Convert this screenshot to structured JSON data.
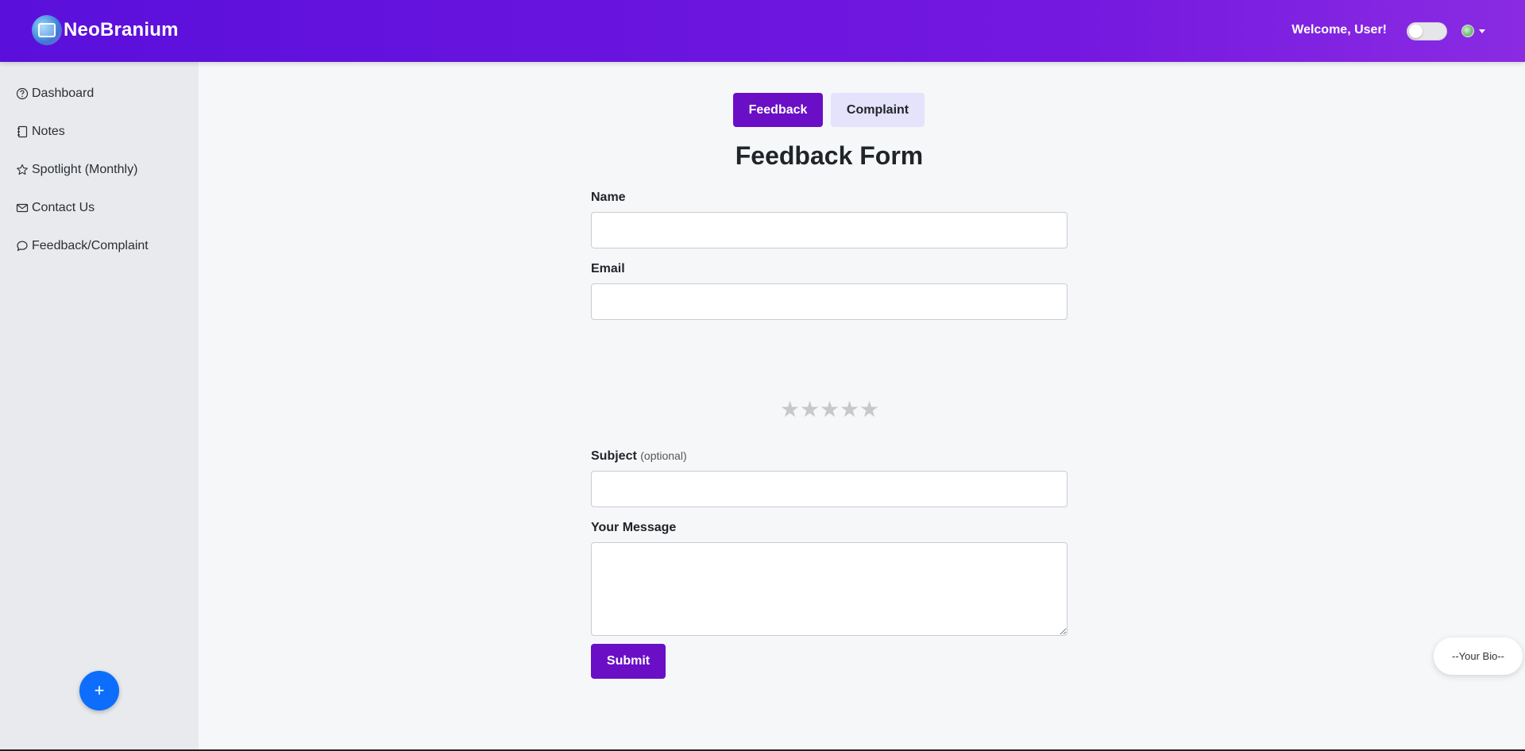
{
  "header": {
    "brand": "NeoBranium",
    "welcome": "Welcome, User!",
    "theme_toggle_on": false
  },
  "sidebar": {
    "items": [
      {
        "label": "Dashboard",
        "icon": "question-circle-icon"
      },
      {
        "label": "Notes",
        "icon": "notebook-icon"
      },
      {
        "label": "Spotlight (Monthly)",
        "icon": "star-icon"
      },
      {
        "label": "Contact Us",
        "icon": "envelope-icon"
      },
      {
        "label": "Feedback/Complaint",
        "icon": "chat-bubble-icon"
      }
    ],
    "fab_label": "+"
  },
  "tabs": {
    "feedback": "Feedback",
    "complaint": "Complaint",
    "active": "Feedback"
  },
  "form": {
    "title": "Feedback Form",
    "name_label": "Name",
    "name_value": "",
    "email_label": "Email",
    "email_value": "",
    "rating": {
      "value": 0,
      "max": 5,
      "star_char": "★"
    },
    "subject_label": "Subject",
    "subject_optional": "(optional)",
    "subject_value": "",
    "message_label": "Your Message",
    "message_value": "",
    "submit_label": "Submit"
  },
  "bio": {
    "label": "--Your Bio--"
  },
  "colors": {
    "header_gradient_start": "#5a0fdb",
    "header_gradient_end": "#8a2be2",
    "primary": "#6a0fc6",
    "tab_inactive": "#e4e3fb",
    "fab": "#0d6efd",
    "star_empty": "#c8c8c8"
  }
}
